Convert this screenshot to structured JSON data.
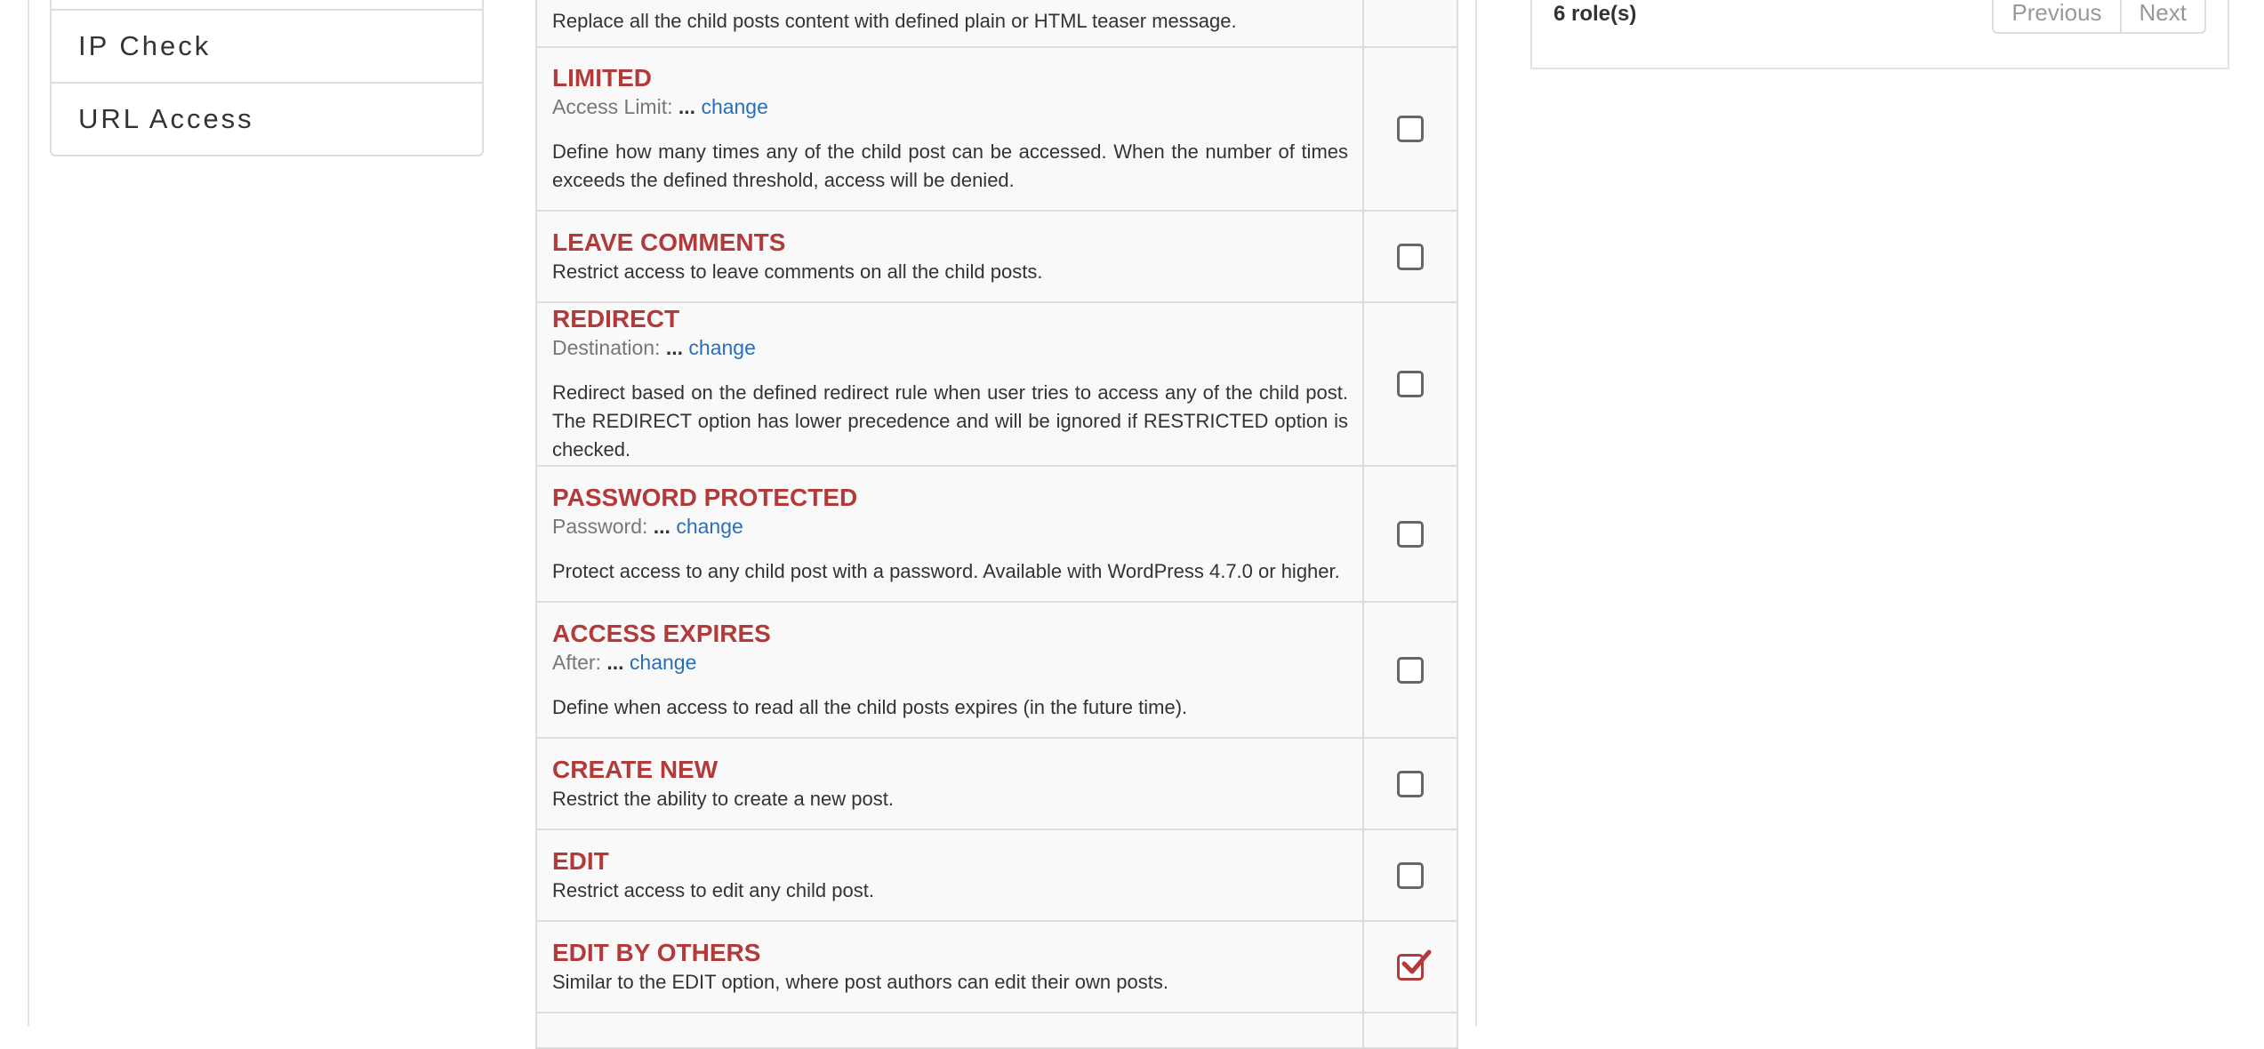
{
  "sidebar": {
    "items": [
      {
        "label": "IP Check"
      },
      {
        "label": "URL Access"
      }
    ]
  },
  "options": {
    "top_partial": {
      "description": "Replace all the child posts content with defined plain or HTML teaser message.",
      "checked": false
    },
    "rows": [
      {
        "title": "LIMITED",
        "sub_label": "Access Limit:",
        "sub_value": "...",
        "sub_link": "change",
        "description": "Define how many times any of the child post can be accessed. When the number of times exceeds the defined threshold, access will be denied.",
        "checked": false
      },
      {
        "title": "LEAVE COMMENTS",
        "description": "Restrict access to leave comments on all the child posts.",
        "checked": false
      },
      {
        "title": "REDIRECT",
        "sub_label": "Destination:",
        "sub_value": "...",
        "sub_link": "change",
        "description": "Redirect based on the defined redirect rule when user tries to access any of the child post. The REDIRECT option has lower precedence and will be ignored if RESTRICTED option is checked.",
        "checked": false
      },
      {
        "title": "PASSWORD PROTECTED",
        "sub_label": "Password:",
        "sub_value": "...",
        "sub_link": "change",
        "description": "Protect access to any child post with a password. Available with WordPress 4.7.0 or higher.",
        "checked": false
      },
      {
        "title": "ACCESS EXPIRES",
        "sub_label": "After:",
        "sub_value": "...",
        "sub_link": "change",
        "description": "Define when access to read all the child posts expires (in the future time).",
        "checked": false
      },
      {
        "title": "CREATE NEW",
        "description": "Restrict the ability to create a new post.",
        "checked": false
      },
      {
        "title": "EDIT",
        "description": "Restrict access to edit any child post.",
        "checked": false
      },
      {
        "title": "EDIT BY OTHERS",
        "description": "Similar to the EDIT option, where post authors can edit their own posts.",
        "checked": true
      }
    ]
  },
  "roles_panel": {
    "count_text": "6 role(s)",
    "previous_label": "Previous",
    "next_label": "Next"
  },
  "colors": {
    "title_red": "#b13a3a",
    "link_blue": "#2a6fb8",
    "border": "#dddddd",
    "row_bg": "#f9f9f9"
  }
}
